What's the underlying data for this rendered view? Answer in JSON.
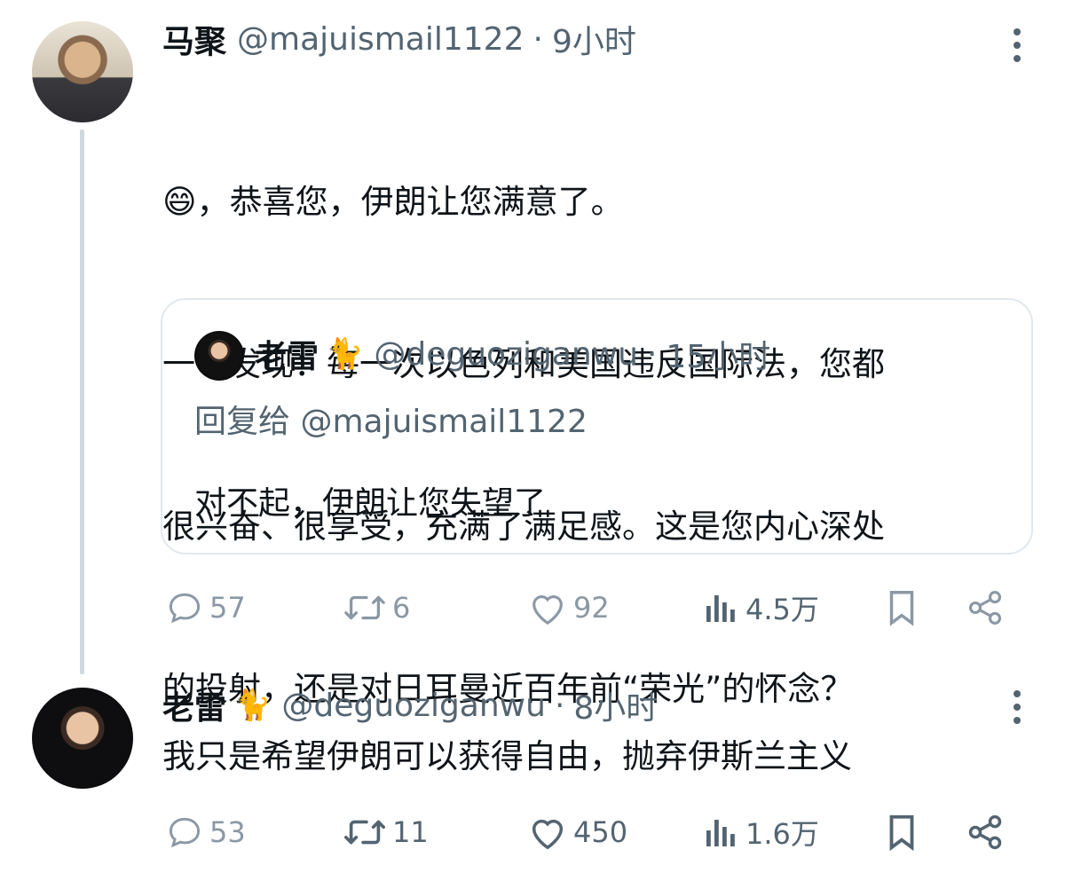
{
  "tweets": [
    {
      "author": {
        "display_name": "马聚",
        "handle": "@majuismail1122",
        "time": "9小时"
      },
      "body_emoji": "😄",
      "body_lines": [
        "，恭喜您，伊朗让您满意了。",
        "一个发现：每一次以色列和美国违反国际法，您都",
        "很兴奋、很享受，充满了满足感。这是您内心深处",
        "的投射，还是对日耳曼近百年前“荣光”的怀念？"
      ],
      "quote": {
        "display_name": "老雷",
        "name_emoji": "🐈",
        "handle": "@deguoziganwu",
        "time": "15小时",
        "reply_to": "回复给 @majuismail1122",
        "text": "对不起，伊朗让您失望了"
      },
      "actions": {
        "replies": "57",
        "retweets": "6",
        "likes": "92",
        "views": "4.5万"
      }
    },
    {
      "author": {
        "display_name": "老雷",
        "name_emoji": "🐈",
        "handle": "@deguoziganwu",
        "time": "8小时"
      },
      "body": "我只是希望伊朗可以获得自由，抛弃伊斯兰主义",
      "actions": {
        "replies": "53",
        "retweets": "11",
        "likes": "450",
        "views": "1.6万"
      }
    }
  ],
  "separator": "·",
  "icons": [
    "reply-icon",
    "retweet-icon",
    "like-icon",
    "views-icon",
    "bookmark-icon",
    "share-icon",
    "more-icon"
  ],
  "colors": {
    "text": "#0f1419",
    "secondary": "#536471",
    "muted": "#8b98a5",
    "border": "#e1e8ed",
    "thread": "#cfd9de"
  }
}
